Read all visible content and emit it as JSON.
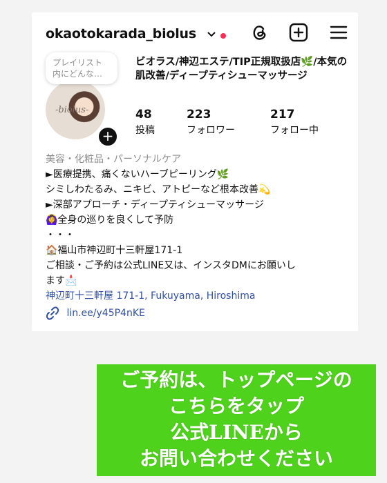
{
  "header": {
    "username": "okaotokarada_biolus",
    "icons": [
      "chevron-down-icon",
      "notification-dot",
      "threads-icon",
      "add-post-icon",
      "menu-icon"
    ],
    "accent": "#ff2d55"
  },
  "profile": {
    "note_bubble": "プレイリスト\n内にどんな…",
    "avatar_text": "-biolus-",
    "name": "ビオラス/神辺エステ/TIP正規取扱店🌿/本気の肌改善/ディープティシューマッサージ",
    "stats": [
      {
        "value": "48",
        "label": "投稿"
      },
      {
        "value": "223",
        "label": "フォロワー"
      },
      {
        "value": "217",
        "label": "フォロー中"
      }
    ]
  },
  "bio": {
    "category": "美容・化粧品・パーソナルケア",
    "lines": [
      "►医療提携、痛くないハーブピーリング🌿",
      "シミしわたるみ、ニキビ、アトピーなど根本改善💫",
      "►深部アプローチ・ディープティシューマッサージ",
      "🙆‍♀️全身の巡りを良くして予防",
      "・・・",
      "🏠福山市神辺町十三軒屋171-1",
      "ご相談・ご予約は公式LINE又は、インスタDMにお願いし",
      "ます📩"
    ],
    "location": "神辺町十三軒屋 171-1, Fukuyama, Hiroshima",
    "link": "lin.ee/y45P4nKE",
    "link_color": "#2f4fa6"
  },
  "banner": {
    "lines": [
      "ご予約は、トップページの",
      "こちらをタップ",
      "公式LINEから",
      "お問い合わせください"
    ],
    "background": "#4fd21c"
  }
}
